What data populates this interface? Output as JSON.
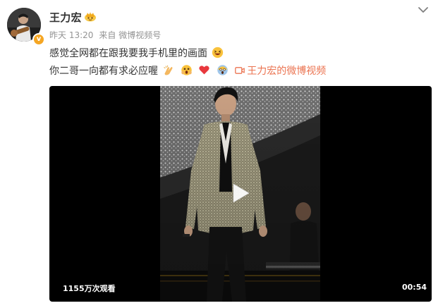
{
  "post": {
    "author": "王力宏",
    "time": "昨天 13:20",
    "source": "来自 微博视频号",
    "text_line1": "感觉全网都在跟我要我手机里的画面",
    "text_line2": "你二哥一向都有求必应喔",
    "video_link_label": "王力宏的微博视频"
  },
  "video": {
    "views": "1155万次观看",
    "duration": "00:54"
  },
  "colors": {
    "link": "#eb7350",
    "meta": "#939393",
    "text": "#333333",
    "badge": "#f5a623"
  },
  "icons": {
    "verify": "verified-v-badge",
    "member": "crown-icon",
    "menu": "chevron-down-icon",
    "play": "play-icon",
    "video_link": "video-camera-icon"
  }
}
